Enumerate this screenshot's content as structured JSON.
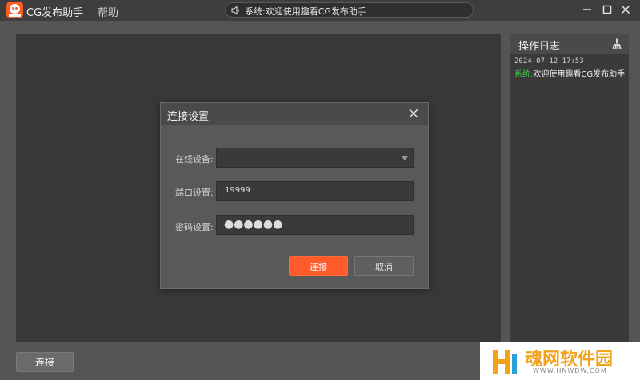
{
  "app": {
    "title": "CG发布助手",
    "menu_help": "帮助",
    "logo_icon": "app-logo-icon"
  },
  "notice": {
    "icon": "speaker-icon",
    "text": "系统:欢迎使用趣看CG发布助手"
  },
  "window_controls": [
    "minimize-icon",
    "maximize-icon",
    "close-icon"
  ],
  "log_panel": {
    "title": "操作日志",
    "clear_icon": "broom-icon",
    "entries": [
      {
        "time": "2024-07-12 17:53",
        "source": "系统:",
        "message": "欢迎使用趣看CG发布助手",
        "source_color": "#3ad13a"
      }
    ]
  },
  "bottom_bar": {
    "connect_label": "连接"
  },
  "dialog": {
    "title": "连接设置",
    "close_icon": "close-icon",
    "device_label": "在线设备:",
    "device_value": "",
    "port_label": "端口设置:",
    "port_value": "19999",
    "password_label": "密码设置:",
    "password_mask": "●●●●●●",
    "ok_label": "连接",
    "cancel_label": "取消",
    "accent": "#ff5a2a"
  },
  "watermark": {
    "main": "魂网软件园",
    "sub": "WWW.HNWDW.COM"
  }
}
